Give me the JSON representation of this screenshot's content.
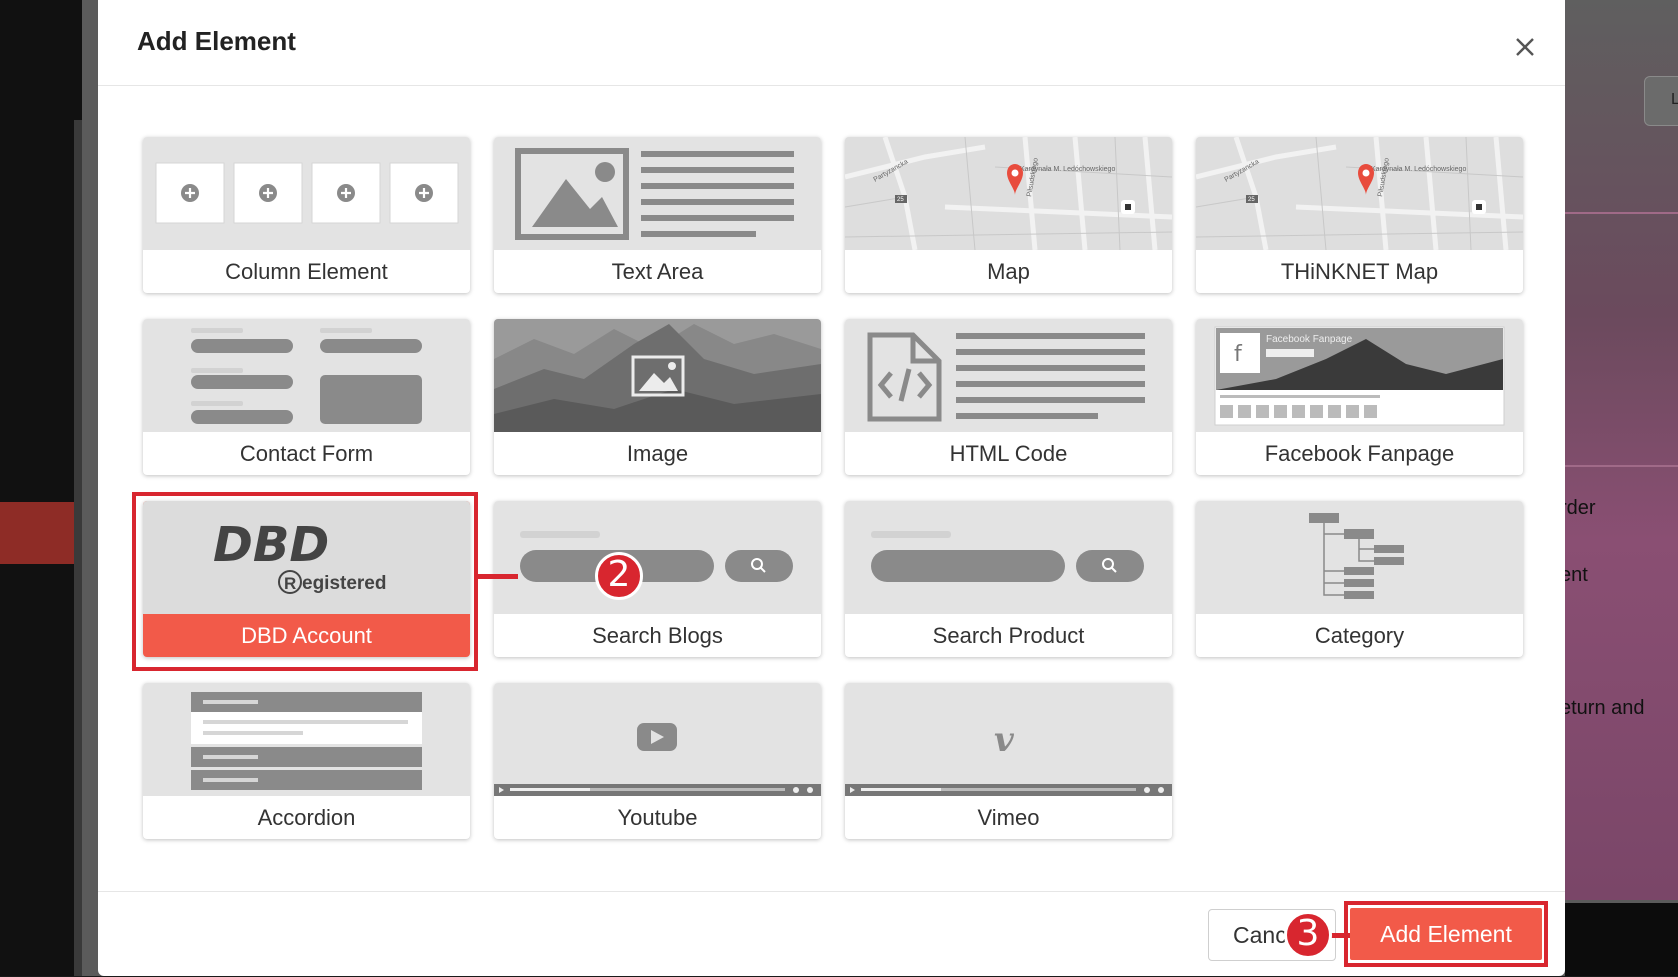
{
  "background": {
    "right_texts": [
      "rder",
      "ent",
      "eturn and"
    ],
    "right_button_label": "L"
  },
  "modal": {
    "title": "Add Element",
    "close_label": "×"
  },
  "cards": [
    {
      "label": "Column Element"
    },
    {
      "label": "Text Area"
    },
    {
      "label": "Map"
    },
    {
      "label": "THiNKNET Map"
    },
    {
      "label": "Contact Form"
    },
    {
      "label": "Image"
    },
    {
      "label": "HTML Code"
    },
    {
      "label": "Facebook Fanpage"
    },
    {
      "label": "DBD Account",
      "selected": true
    },
    {
      "label": "Search Blogs"
    },
    {
      "label": "Search Product"
    },
    {
      "label": "Category"
    },
    {
      "label": "Accordion"
    },
    {
      "label": "Youtube"
    },
    {
      "label": "Vimeo"
    }
  ],
  "thumbs": {
    "dbd_logo": "DBD",
    "dbd_registered": "egistered",
    "dbd_r": "R",
    "facebook_fanpage_caption": "Facebook Fanpage",
    "map_streets": [
      "Kardynała M. Ledóchowskiego",
      "Partyzancka",
      "Piłsudskiego",
      "25"
    ]
  },
  "callouts": {
    "step2": "2",
    "step3": "3"
  },
  "footer": {
    "cancel_label": "Cancel",
    "add_label": "Add Element"
  },
  "colors": {
    "accent": "#f25a49",
    "callout": "#d8262f",
    "thumb_bg": "#e3e3e3",
    "thumb_shape": "#8a8a8a"
  }
}
